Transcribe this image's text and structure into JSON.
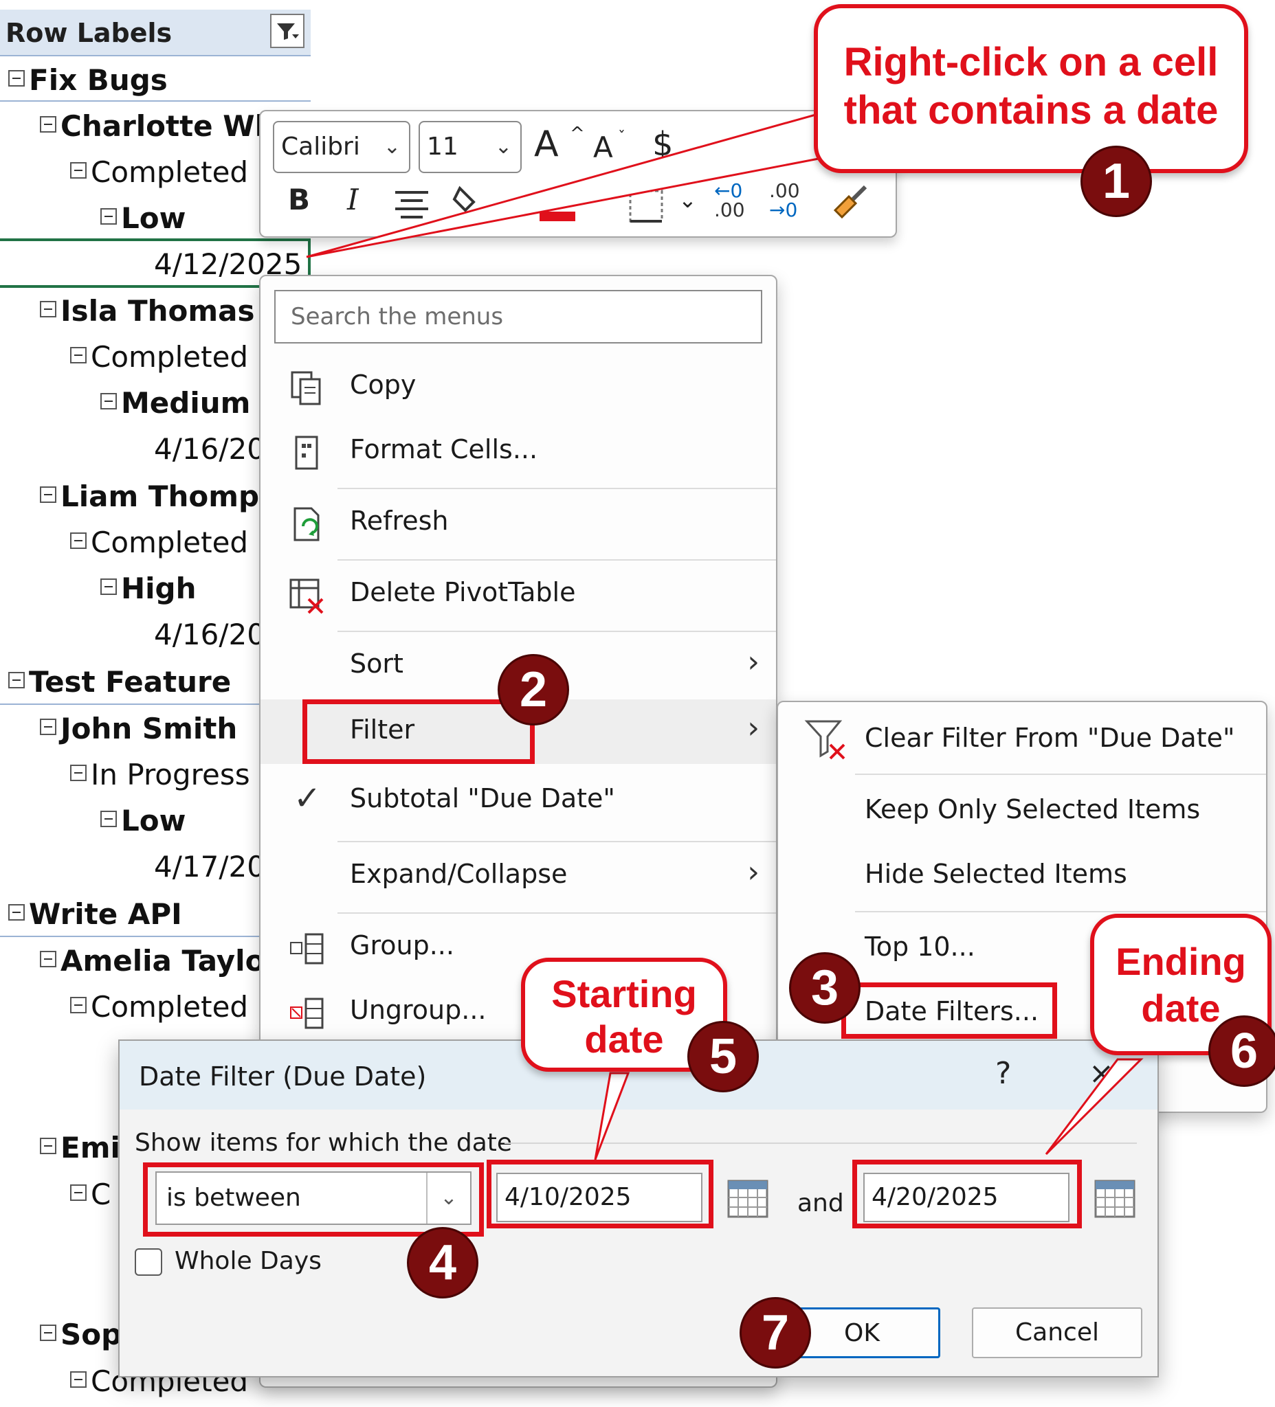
{
  "pivot": {
    "header": "Row Labels",
    "rows": [
      "Fix Bugs",
      "Charlotte Wh",
      "Completed",
      "Low",
      "4/12/2025",
      "Isla Thomas",
      "Completed",
      "Medium",
      "4/16/20",
      "Liam Thomps",
      "Completed",
      "High",
      "4/16/20",
      "Test Feature",
      "John Smith",
      "In Progress",
      "Low",
      "4/17/20",
      "Write API",
      "Amelia Taylor",
      "Completed",
      "Emi",
      "C",
      "Sop",
      "Completed"
    ]
  },
  "mini_toolbar": {
    "font_name": "Calibri",
    "font_size": "11",
    "bold": "B",
    "italic": "I",
    "currency": "$",
    "increase_font": "A",
    "decrease_font": "A",
    "inc_decimal_top": "←0",
    "inc_decimal_bottom": ".00",
    "dec_decimal_top": ".00",
    "dec_decimal_bottom": "→0"
  },
  "context_menu": {
    "search_placeholder": "Search the menus",
    "items": [
      {
        "label": "Copy",
        "icon": "copy-icon"
      },
      {
        "label": "Format Cells...",
        "icon": "format-cells-icon"
      },
      {
        "label": "Refresh",
        "icon": "refresh-icon"
      },
      {
        "label": "Delete PivotTable",
        "icon": "delete-pivottable-icon"
      },
      {
        "label": "Sort",
        "icon": "submenu-arrow-icon"
      },
      {
        "label": "Filter",
        "icon": "submenu-arrow-icon"
      },
      {
        "label": "Subtotal \"Due Date\"",
        "icon": "checkmark-icon"
      },
      {
        "label": "Expand/Collapse",
        "icon": "submenu-arrow-icon"
      },
      {
        "label": "Group...",
        "icon": "group-icon"
      },
      {
        "label": "Ungroup...",
        "icon": "ungroup-icon"
      }
    ]
  },
  "filter_submenu": {
    "items": [
      {
        "label": "Clear Filter From \"Due Date\"",
        "icon": "clear-filter-icon"
      },
      {
        "label": "Keep Only Selected Items"
      },
      {
        "label": "Hide Selected Items"
      },
      {
        "label": "Top 10..."
      },
      {
        "label": "Date Filters..."
      }
    ]
  },
  "dialog": {
    "title": "Date Filter (Due Date)",
    "help": "?",
    "close": "×",
    "prompt": "Show items for which the date",
    "condition": "is between",
    "start_date": "4/10/2025",
    "and_label": "and",
    "end_date": "4/20/2025",
    "whole_days_label": "Whole Days",
    "whole_days_checked": false,
    "ok_label": "OK",
    "cancel_label": "Cancel"
  },
  "annotations": {
    "callout_1": "Right-click on a cell that contains a date",
    "callout_start": "Starting date",
    "callout_end": "Ending date",
    "badges": [
      "1",
      "2",
      "3",
      "4",
      "5",
      "6",
      "7"
    ]
  },
  "colors": {
    "annotation_red": "#e0101b",
    "badge_maroon": "#7a0d0e",
    "pivot_header_bg": "#dce6f2",
    "selection_green": "#217346",
    "ok_border_blue": "#0067c0"
  }
}
